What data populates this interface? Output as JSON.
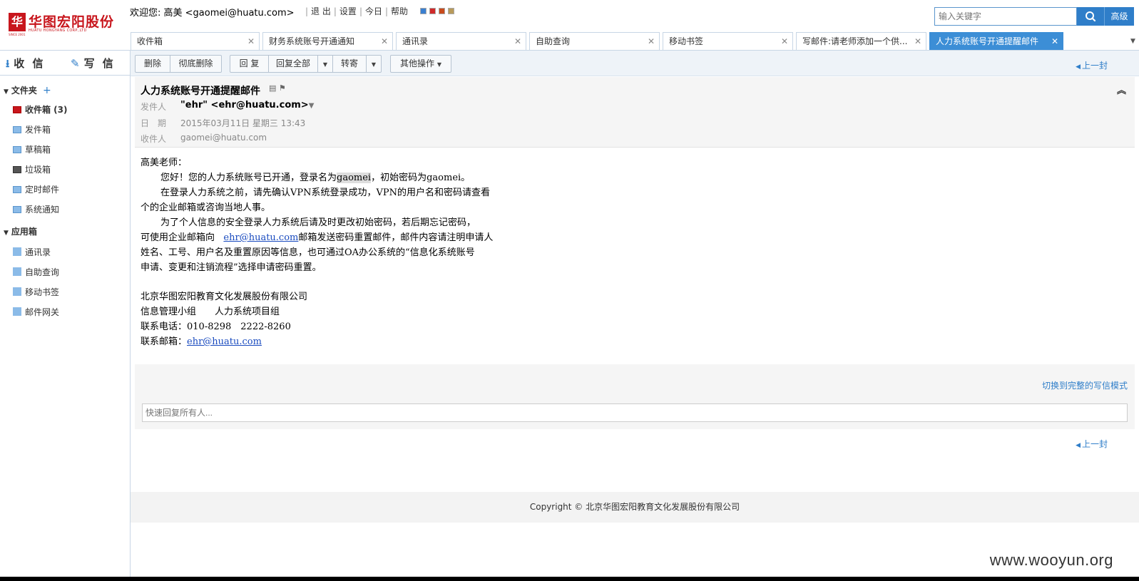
{
  "logo": {
    "mark": "华",
    "name_cn": "华图宏阳股份",
    "name_en": "HUATU HONGYANG CORP.,LTD",
    "since": "SINCE 2001"
  },
  "header": {
    "welcome": "欢迎您: 高美 <gaomei@huatu.com>",
    "links": [
      "退 出",
      "设置",
      "今日",
      "帮助"
    ],
    "skins": [
      "#3a7fd0",
      "#d02a2a",
      "#c84b1c",
      "#b89a5a"
    ],
    "search_placeholder": "输入关键字",
    "advanced_label": "高级"
  },
  "tabs": [
    {
      "label": "收件箱",
      "active": false
    },
    {
      "label": "财务系统账号开通通知",
      "active": false
    },
    {
      "label": "通讯录",
      "active": false
    },
    {
      "label": "自助查询",
      "active": false
    },
    {
      "label": "移动书签",
      "active": false
    },
    {
      "label": "写邮件:请老师添加一个供...",
      "active": false
    },
    {
      "label": "人力系统账号开通提醒邮件",
      "active": true
    }
  ],
  "sidebar": {
    "receive_label": "收 信",
    "compose_label": "写 信",
    "folders_title": "文件夹",
    "folders": [
      {
        "label": "收件箱 (3)",
        "bold": true,
        "icon": "inbox-icon"
      },
      {
        "label": "发件箱",
        "bold": false,
        "icon": "folder-icon"
      },
      {
        "label": "草稿箱",
        "bold": false,
        "icon": "folder-icon"
      },
      {
        "label": "垃圾箱",
        "bold": false,
        "icon": "trash-folder-icon"
      },
      {
        "label": "定时邮件",
        "bold": false,
        "icon": "folder-icon"
      },
      {
        "label": "系统通知",
        "bold": false,
        "icon": "folder-icon"
      }
    ],
    "apps_title": "应用箱",
    "apps": [
      "通讯录",
      "自助查询",
      "移动书签",
      "邮件网关"
    ]
  },
  "toolbar": {
    "delete": "删除",
    "delete_permanent": "彻底删除",
    "reply": "回 复",
    "reply_all": "回复全部",
    "forward": "转寄",
    "more": "其他操作",
    "prev": "上一封"
  },
  "mail": {
    "subject": "人力系统账号开通提醒邮件",
    "from_label": "发件人",
    "from": "\"ehr\" <ehr@huatu.com>",
    "date_label": "日　期",
    "date": "2015年03月11日 星期三 13:43",
    "to_label": "收件人",
    "to": "gaomei@huatu.com",
    "greeting": "高美老师：",
    "p1_a": "您好！您的人力系统账号已开通，登录名为",
    "p1_login": "gaomei",
    "p1_b": "，初始密码为gaomei。",
    "p2_a": "在登录人力系统之前，请先确认VPN系统登录成功，VPN的用户名和密码请查看",
    "p2_b": "个的企业邮箱或咨询当地人事。",
    "p3_a": "为了个人信息的安全登录人力系统后请及时更改初始密码，若后期忘记密码，",
    "p3_b": "可使用企业邮箱向",
    "p3_link": "ehr@huatu.com",
    "p3_c": "邮箱发送密码重置邮件，邮件内容请注明申请人",
    "p3_d": "姓名、工号、用户名及重置原因等信息，也可通过OA办公系统的“信息化系统账号",
    "p3_e": "申请、变更和注销流程”选择申请密码重置。",
    "sig_company": "北京华图宏阳教育文化发展股份有限公司",
    "sig_dept": "信息管理小组　　人力系统项目组",
    "sig_phone": "联系电话：010-8298　2222-8260",
    "sig_email_label": "联系邮箱：",
    "sig_email": "ehr@huatu.com"
  },
  "quick_reply": {
    "switch_label": "切换到完整的写信模式",
    "placeholder": "快速回复所有人..."
  },
  "footer": {
    "copyright": "Copyright © 北京华图宏阳教育文化发展股份有限公司"
  },
  "watermark": "www.wooyun.org"
}
